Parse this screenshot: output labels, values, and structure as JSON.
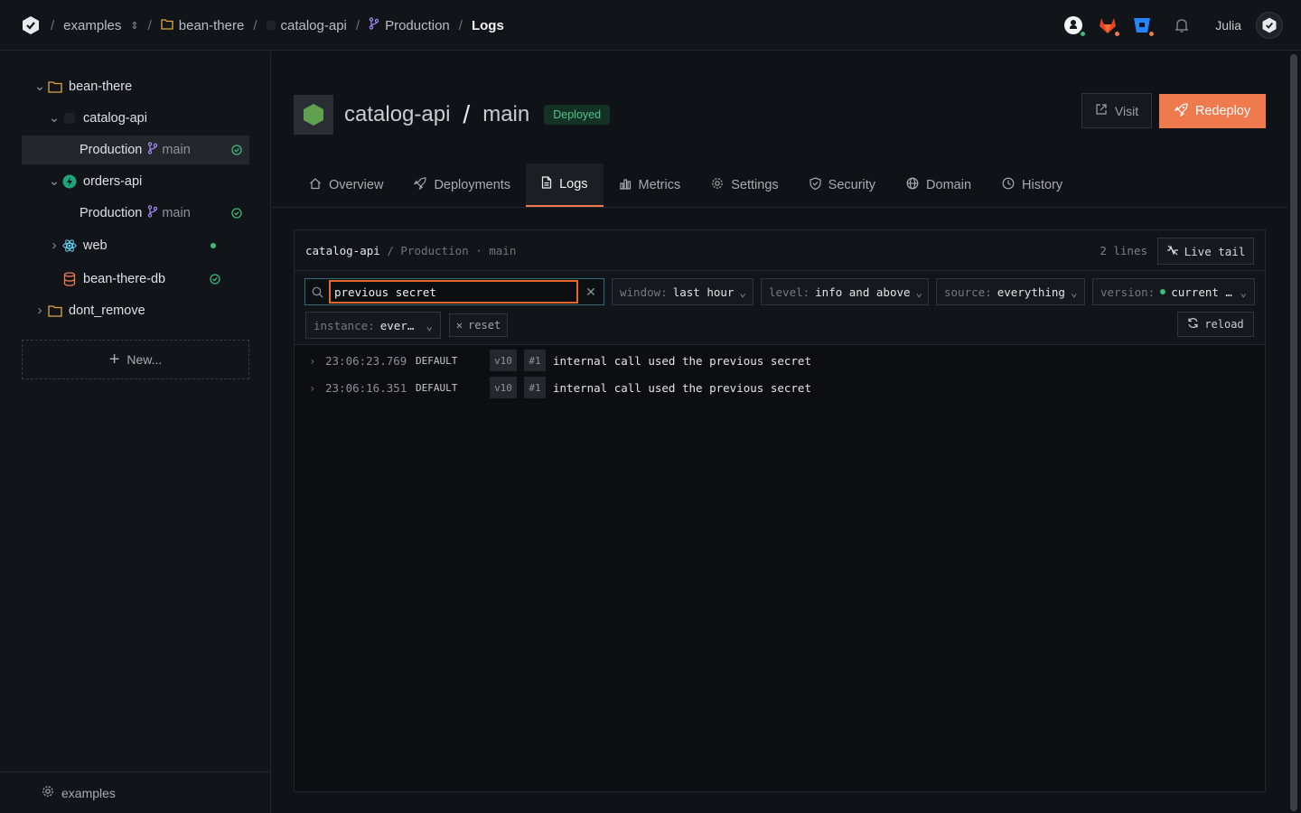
{
  "breadcrumb": {
    "team": "examples",
    "project": "bean-there",
    "service": "catalog-api",
    "environment": "Production",
    "page": "Logs"
  },
  "user": {
    "name": "Julia"
  },
  "sidebar": {
    "tree": [
      {
        "label": "bean-there",
        "type": "folder",
        "expanded": true
      },
      {
        "label": "catalog-api",
        "type": "service",
        "expanded": true
      },
      {
        "label": "Production",
        "branch": "main",
        "status": "healthy",
        "selected": true
      },
      {
        "label": "orders-api",
        "type": "service",
        "expanded": true
      },
      {
        "label": "Production",
        "branch": "main",
        "status": "healthy"
      },
      {
        "label": "web",
        "type": "service",
        "expanded": false,
        "status": "running"
      },
      {
        "label": "bean-there-db",
        "type": "database",
        "status": "healthy"
      },
      {
        "label": "dont_remove",
        "type": "folder",
        "expanded": false
      }
    ],
    "new_label": "New...",
    "footer_label": "examples"
  },
  "header": {
    "service": "catalog-api",
    "separator": "/",
    "branch": "main",
    "status": "Deployed",
    "visit_label": "Visit",
    "redeploy_label": "Redeploy"
  },
  "tabs": [
    {
      "label": "Overview",
      "icon": "home-icon"
    },
    {
      "label": "Deployments",
      "icon": "rocket-icon"
    },
    {
      "label": "Logs",
      "icon": "file-icon",
      "active": true
    },
    {
      "label": "Metrics",
      "icon": "bar-chart-icon"
    },
    {
      "label": "Settings",
      "icon": "gear-icon"
    },
    {
      "label": "Security",
      "icon": "shield-icon"
    },
    {
      "label": "Domain",
      "icon": "globe-icon"
    },
    {
      "label": "History",
      "icon": "clock-icon"
    }
  ],
  "logs": {
    "service": "catalog-api",
    "slash": "/",
    "environment": "Production",
    "dot": "·",
    "branch": "main",
    "line_count": "2 lines",
    "live_tail_label": "Live tail",
    "search_value": "previous secret",
    "filters": {
      "window": {
        "key": "window:",
        "value": "last hour"
      },
      "level": {
        "key": "level:",
        "value": "info and above"
      },
      "source": {
        "key": "source:",
        "value": "everything"
      },
      "version": {
        "key": "version:",
        "value": "current …"
      },
      "instance": {
        "key": "instance:",
        "value": "ever…"
      }
    },
    "reset_label": "reset",
    "reload_label": "reload",
    "entries": [
      {
        "time": "23:06:23.769",
        "level": "DEFAULT",
        "version": "v10",
        "instance": "#1",
        "message": "internal call used the previous secret"
      },
      {
        "time": "23:06:16.351",
        "level": "DEFAULT",
        "version": "v10",
        "instance": "#1",
        "message": "internal call used the previous secret"
      }
    ]
  },
  "colors": {
    "accent": "#ee7a4e",
    "healthy": "#3fb97a",
    "branch": "#a78bfa",
    "folder": "#e3a83a"
  }
}
